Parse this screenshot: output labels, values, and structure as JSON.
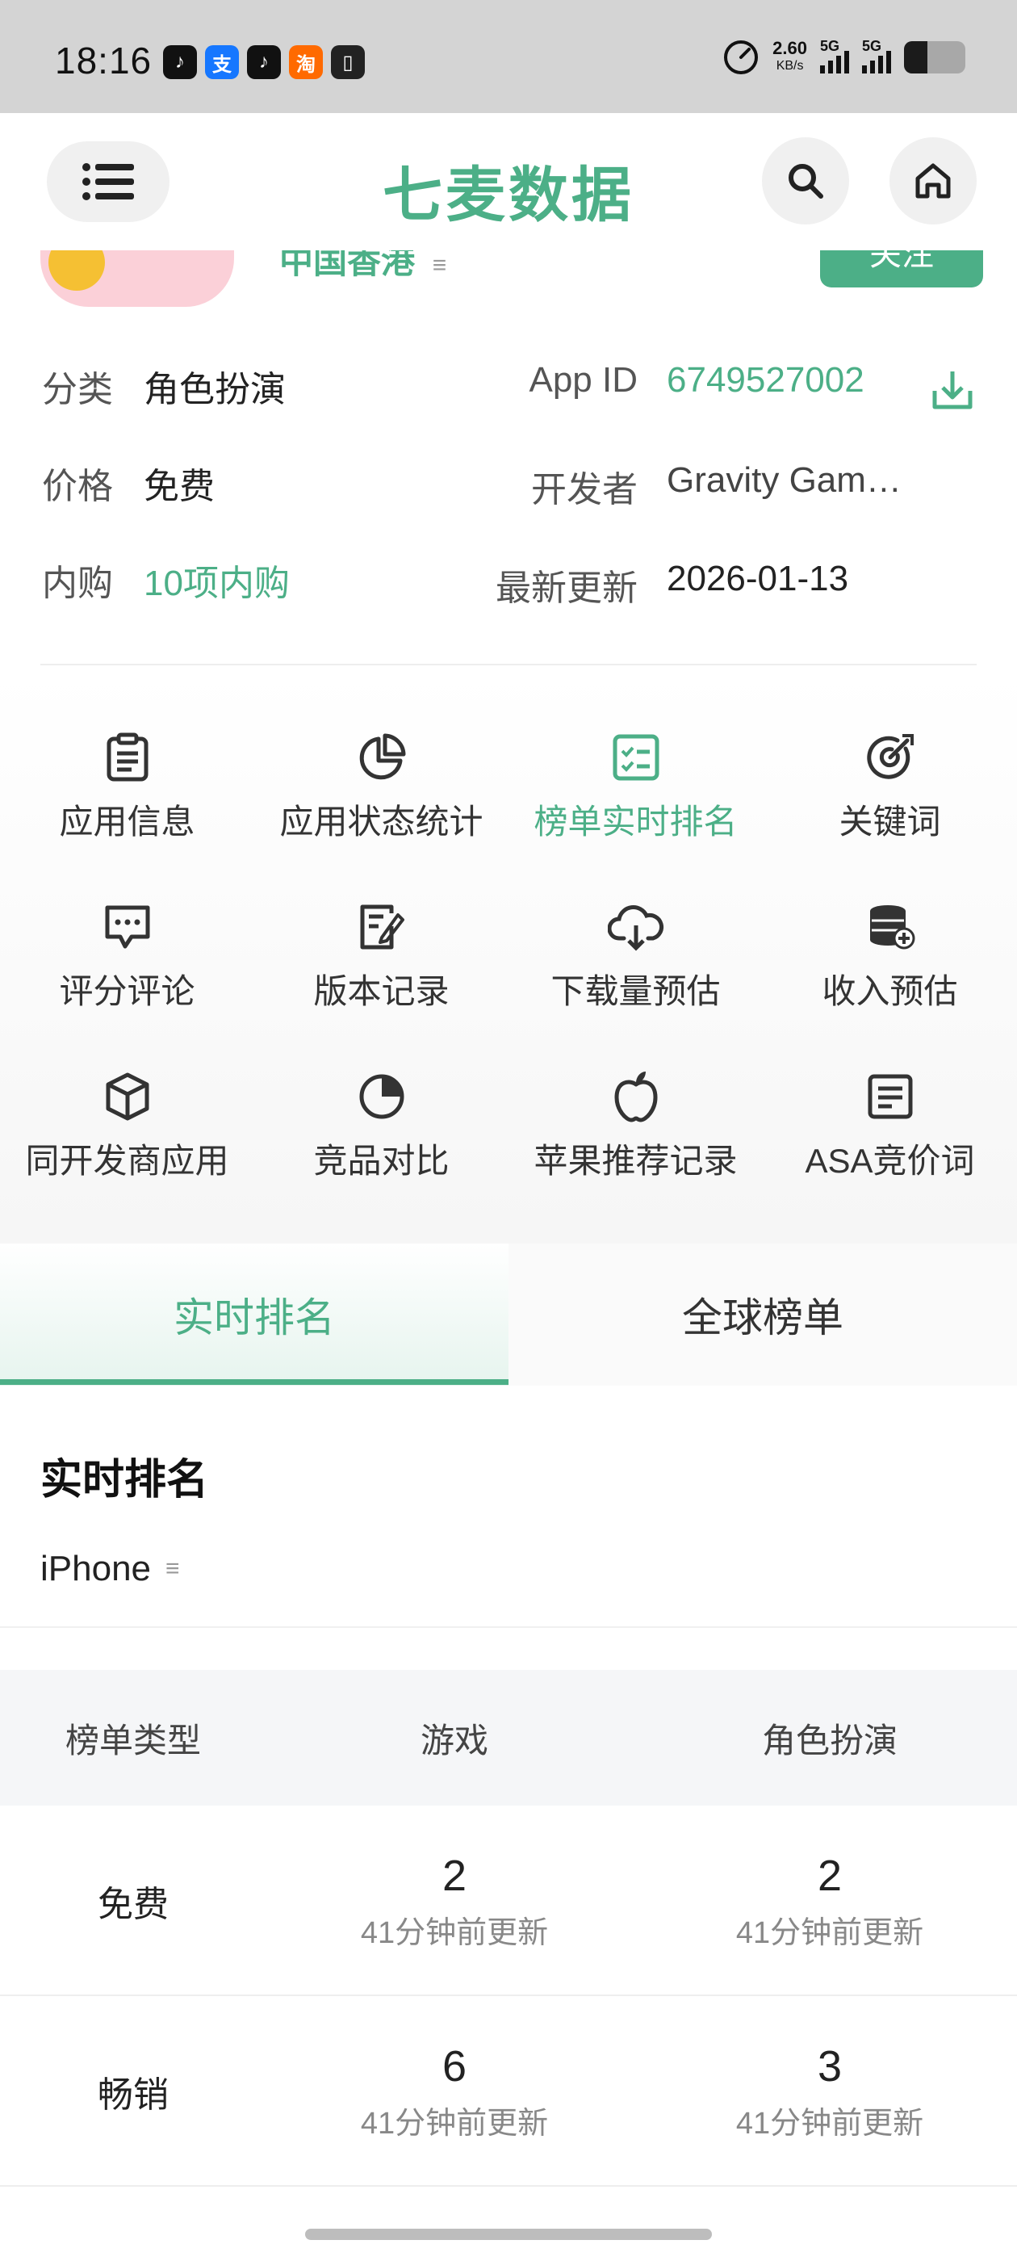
{
  "status_bar": {
    "time": "18:16",
    "apps": [
      "tiktok-icon",
      "alipay-icon",
      "tiktok-icon",
      "taobao-icon",
      "notes-icon"
    ],
    "app_glyphs": [
      "♪",
      "支",
      "♪",
      "淘",
      "▯"
    ],
    "net_speed": "2.60",
    "net_unit": "KB/s",
    "sig1": "5G",
    "sig2": "5G",
    "battery_level": 0.38
  },
  "header": {
    "brand": "七麦数据"
  },
  "app_card": {
    "region": "中国香港",
    "follow_label": "关注"
  },
  "info": {
    "category_label": "分类",
    "category_value": "角色扮演",
    "appid_label": "App ID",
    "appid_value": "6749527002",
    "price_label": "价格",
    "price_value": "免费",
    "developer_label": "开发者",
    "developer_value": "Gravity Gam…",
    "iap_label": "内购",
    "iap_value": "10项内购",
    "update_label": "最新更新",
    "update_value": "2026-01-13"
  },
  "features": [
    {
      "label": "应用信息",
      "icon": "clipboard-icon"
    },
    {
      "label": "应用状态统计",
      "icon": "pie-chart-icon"
    },
    {
      "label": "榜单实时排名",
      "icon": "ranking-list-icon",
      "active": true
    },
    {
      "label": "关键词",
      "icon": "target-icon"
    },
    {
      "label": "评分评论",
      "icon": "comment-icon"
    },
    {
      "label": "版本记录",
      "icon": "edit-doc-icon"
    },
    {
      "label": "下载量预估",
      "icon": "cloud-download-icon"
    },
    {
      "label": "收入预估",
      "icon": "coins-icon"
    },
    {
      "label": "同开发商应用",
      "icon": "cube-icon"
    },
    {
      "label": "竞品对比",
      "icon": "pie-compare-icon"
    },
    {
      "label": "苹果推荐记录",
      "icon": "apple-icon"
    },
    {
      "label": "ASA竞价词",
      "icon": "document-lines-icon"
    }
  ],
  "tabs": {
    "realtime": "实时排名",
    "global": "全球榜单"
  },
  "ranking": {
    "section_title": "实时排名",
    "device": "iPhone",
    "headers": [
      "榜单类型",
      "游戏",
      "角色扮演"
    ],
    "rows": [
      {
        "type": "免费",
        "c1_rank": "2",
        "c1_upd": "41分钟前更新",
        "c2_rank": "2",
        "c2_upd": "41分钟前更新"
      },
      {
        "type": "畅销",
        "c1_rank": "6",
        "c1_upd": "41分钟前更新",
        "c2_rank": "3",
        "c2_upd": "41分钟前更新"
      }
    ]
  },
  "colors": {
    "accent": "#4caf87",
    "status_bar_bg": "#d4d4d4",
    "table_header_bg": "#f5f6f8"
  }
}
